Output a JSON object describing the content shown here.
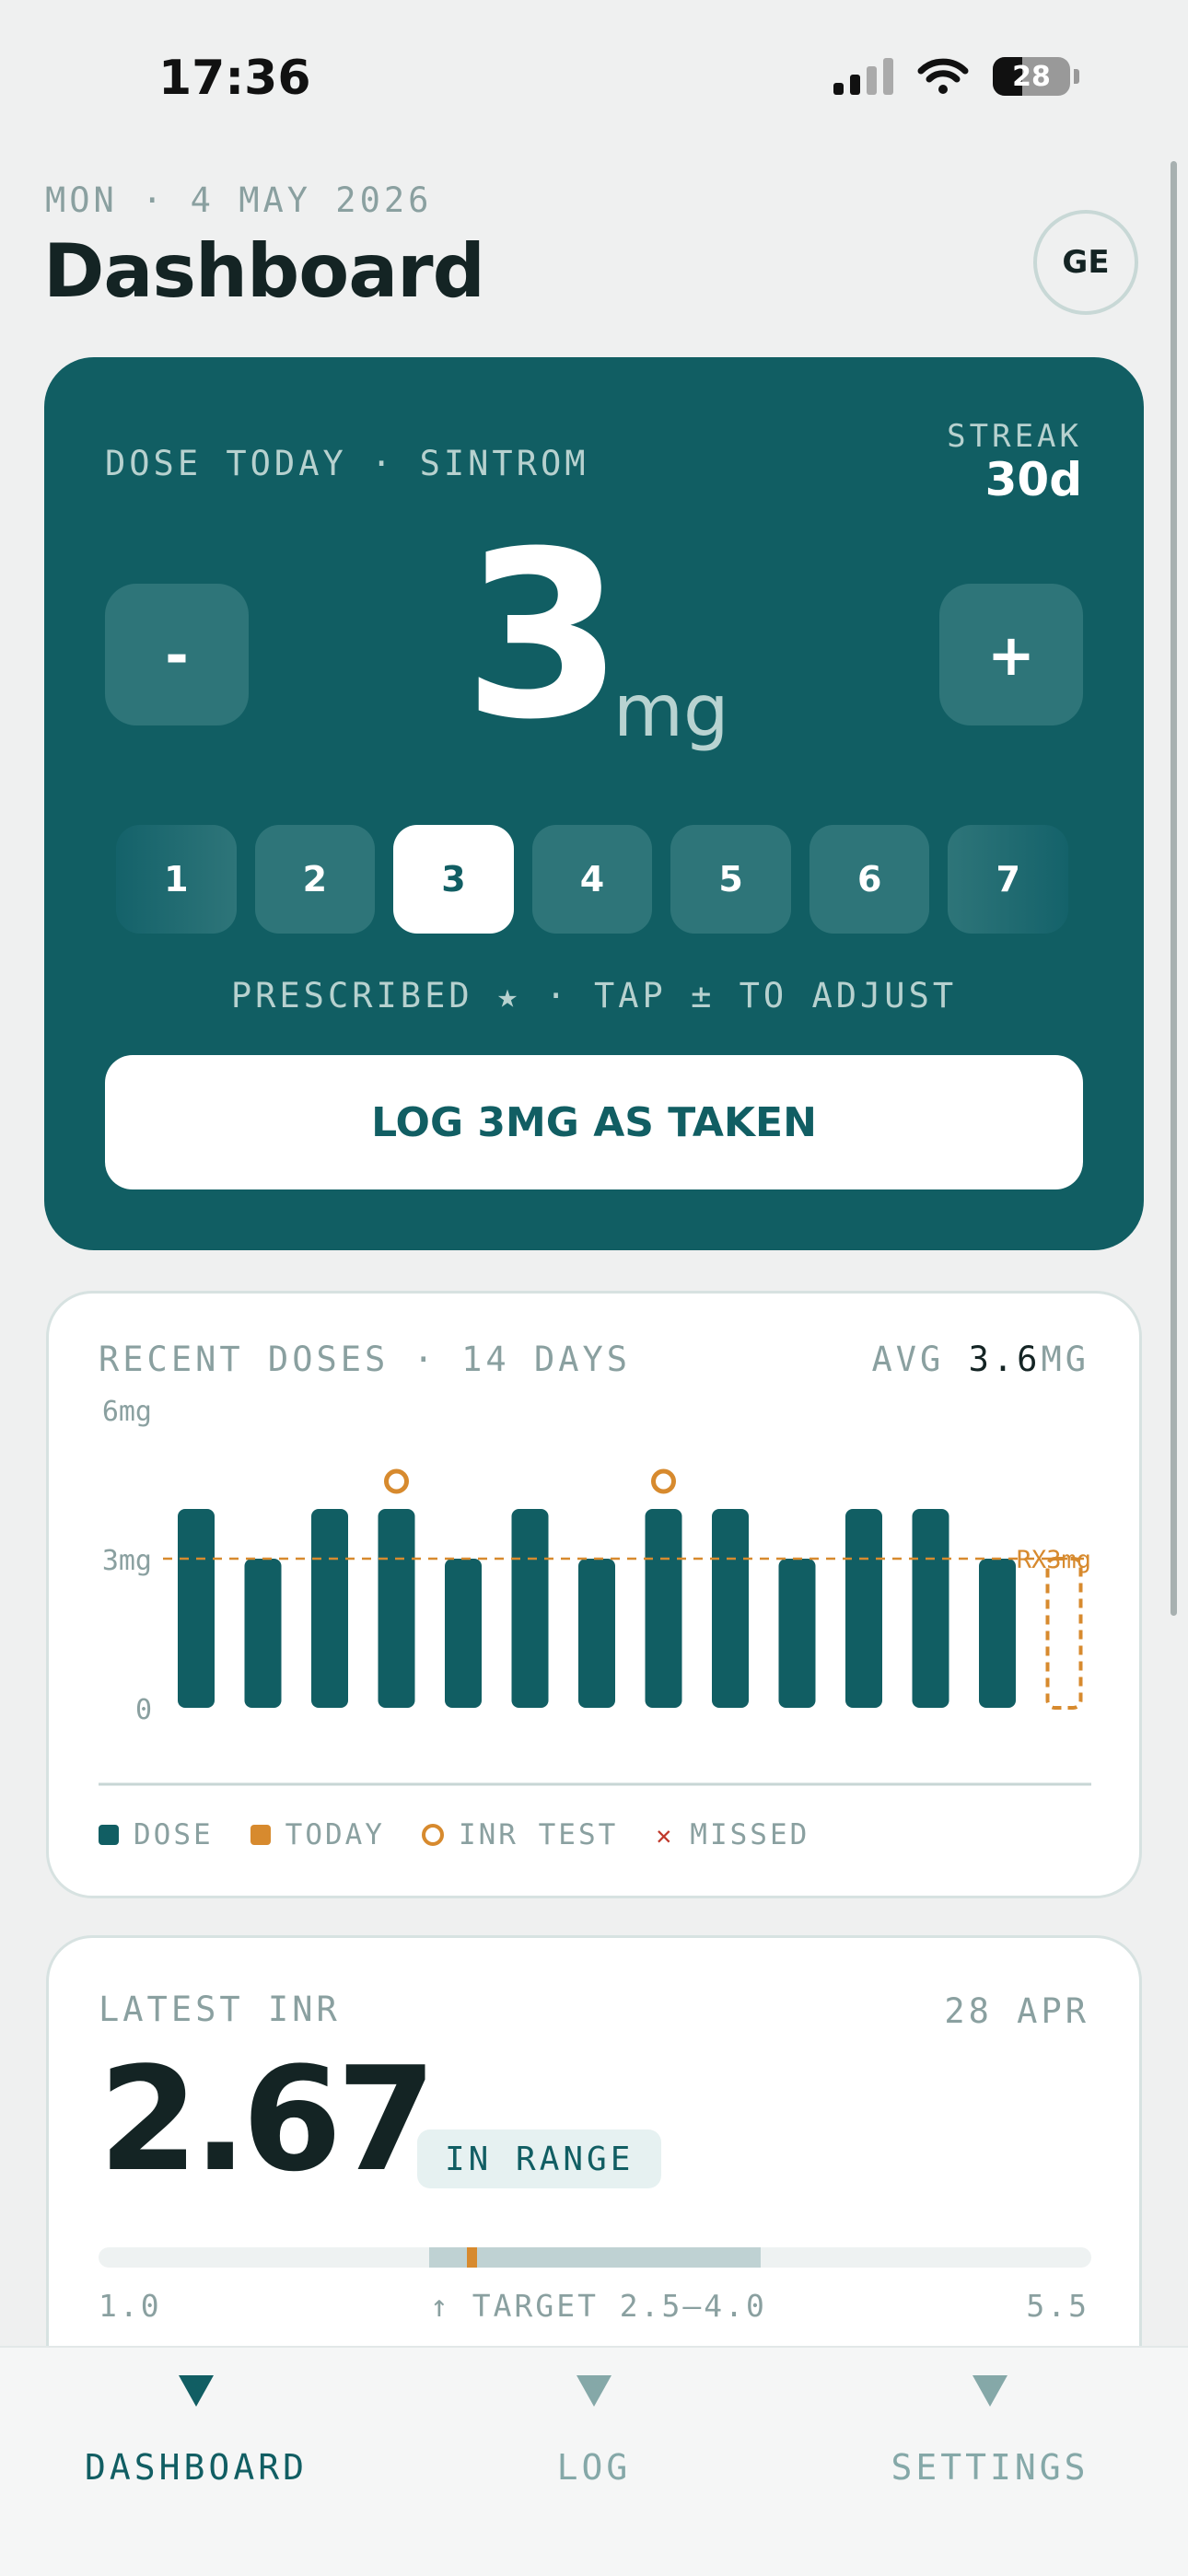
{
  "status_bar": {
    "time": "17:36",
    "battery": "28"
  },
  "header": {
    "date": "MON · 4 MAY 2026",
    "title": "Dashboard",
    "avatar_initials": "GE"
  },
  "dose_card": {
    "label": "DOSE TODAY · SINTROM",
    "streak_label": "STREAK",
    "streak_value": "30d",
    "minus_label": "-",
    "plus_label": "+",
    "dose_value": "3",
    "dose_unit": "mg",
    "chips": [
      "1",
      "2",
      "3",
      "4",
      "5",
      "6",
      "7"
    ],
    "selected_chip": "3",
    "hint": "PRESCRIBED ★ · TAP ± TO ADJUST",
    "log_button": "LOG 3MG AS TAKEN"
  },
  "recent_doses": {
    "title": "RECENT DOSES · 14 DAYS",
    "avg_label": "AVG",
    "avg_value": "3.6",
    "avg_unit": "MG",
    "legend": {
      "dose": "DOSE",
      "today": "TODAY",
      "inr_test": "INR TEST",
      "missed": "MISSED"
    },
    "colors": {
      "dose": "#115e63",
      "today": "#d78a2e",
      "missed": "#c0392b"
    }
  },
  "chart_data": {
    "type": "bar",
    "x": [
      1,
      2,
      3,
      4,
      5,
      6,
      7,
      8,
      9,
      10,
      11,
      12,
      13,
      14
    ],
    "values": [
      4,
      3,
      4,
      4,
      3,
      4,
      3,
      4,
      4,
      3,
      4,
      4,
      3,
      null
    ],
    "today_index": 13,
    "today_value": 3,
    "inr_test_indices": [
      3,
      7
    ],
    "y_ticks": [
      "0",
      "3mg",
      "6mg"
    ],
    "ylim": [
      0,
      6
    ],
    "reference_line": {
      "value": 3,
      "label": "RX3mg"
    },
    "grid": false
  },
  "latest_inr": {
    "title": "LATEST INR",
    "date": "28 APR",
    "value": "2.67",
    "value_number": 2.67,
    "status": "IN RANGE",
    "scale_min": "1.0",
    "scale_max": "5.5",
    "scale_min_number": 1.0,
    "scale_max_number": 5.5,
    "target_label": "↑ TARGET 2.5–4.0",
    "target_low": 2.5,
    "target_high": 4.0
  },
  "tabs": [
    {
      "label": "DASHBOARD",
      "active": true
    },
    {
      "label": "LOG",
      "active": false
    },
    {
      "label": "SETTINGS",
      "active": false
    }
  ]
}
